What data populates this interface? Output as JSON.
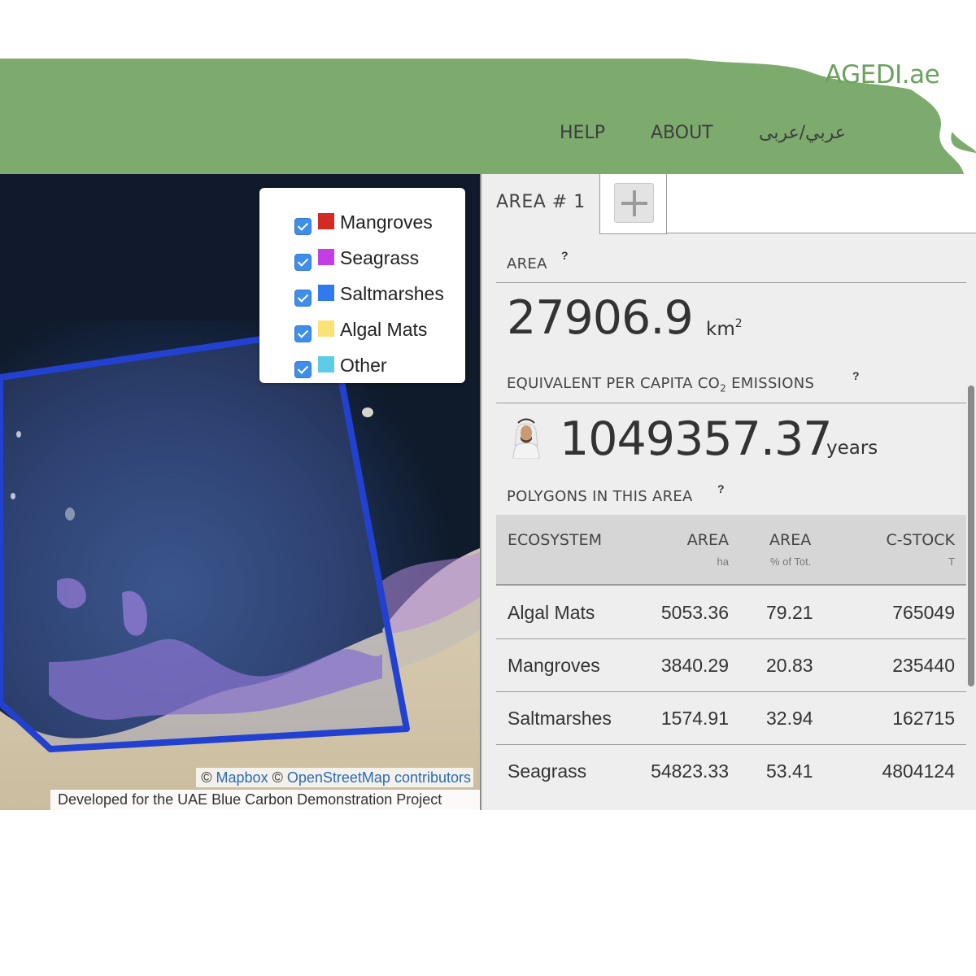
{
  "header": {
    "brand": "AGEDI.ae",
    "nav": {
      "help": "HELP",
      "about": "ABOUT",
      "language": "عربي/عربى"
    }
  },
  "map": {
    "legend": [
      {
        "label": "Mangroves",
        "color": "#d12b23",
        "checked": true
      },
      {
        "label": "Seagrass",
        "color": "#c33ee3",
        "checked": true
      },
      {
        "label": "Saltmarshes",
        "color": "#2f7bed",
        "checked": true
      },
      {
        "label": "Algal Mats",
        "color": "#fbe277",
        "checked": true
      },
      {
        "label": "Other",
        "color": "#5dcce8",
        "checked": true
      }
    ],
    "attribution": {
      "prefix": "©",
      "mapbox": "Mapbox",
      "mid": "©",
      "osm": "OpenStreetMap contributors"
    },
    "dev_note": "Developed for the UAE Blue Carbon Demonstration Project"
  },
  "panel": {
    "tabs": [
      {
        "label": "AREA # 1",
        "active": true
      }
    ],
    "add_tab_icon": "plus-icon",
    "area": {
      "label": "AREA",
      "value": "27906.9",
      "unit": "km",
      "unit_sup": "2"
    },
    "emissions": {
      "label_pre": "EQUIVALENT PER CAPITA CO",
      "label_sub": "2",
      "label_post": " EMISSIONS",
      "value": "1049357.37",
      "unit": "years"
    },
    "polygons_label": "POLYGONS IN THIS AREA",
    "help_marker": "?",
    "table": {
      "headers": [
        {
          "label": "ECOSYSTEM",
          "sub": ""
        },
        {
          "label": "AREA",
          "sub": "ha"
        },
        {
          "label": "AREA",
          "sub": "% of Tot."
        },
        {
          "label": "C-STOCK",
          "sub": "T"
        }
      ],
      "rows": [
        {
          "ecosystem": "Algal Mats",
          "area_ha": "5053.36",
          "area_pct": "79.21",
          "c_stock": "765049"
        },
        {
          "ecosystem": "Mangroves",
          "area_ha": "3840.29",
          "area_pct": "20.83",
          "c_stock": "235440"
        },
        {
          "ecosystem": "Saltmarshes",
          "area_ha": "1574.91",
          "area_pct": "32.94",
          "c_stock": "162715"
        },
        {
          "ecosystem": "Seagrass",
          "area_ha": "54823.33",
          "area_pct": "53.41",
          "c_stock": "4804124"
        }
      ]
    }
  }
}
